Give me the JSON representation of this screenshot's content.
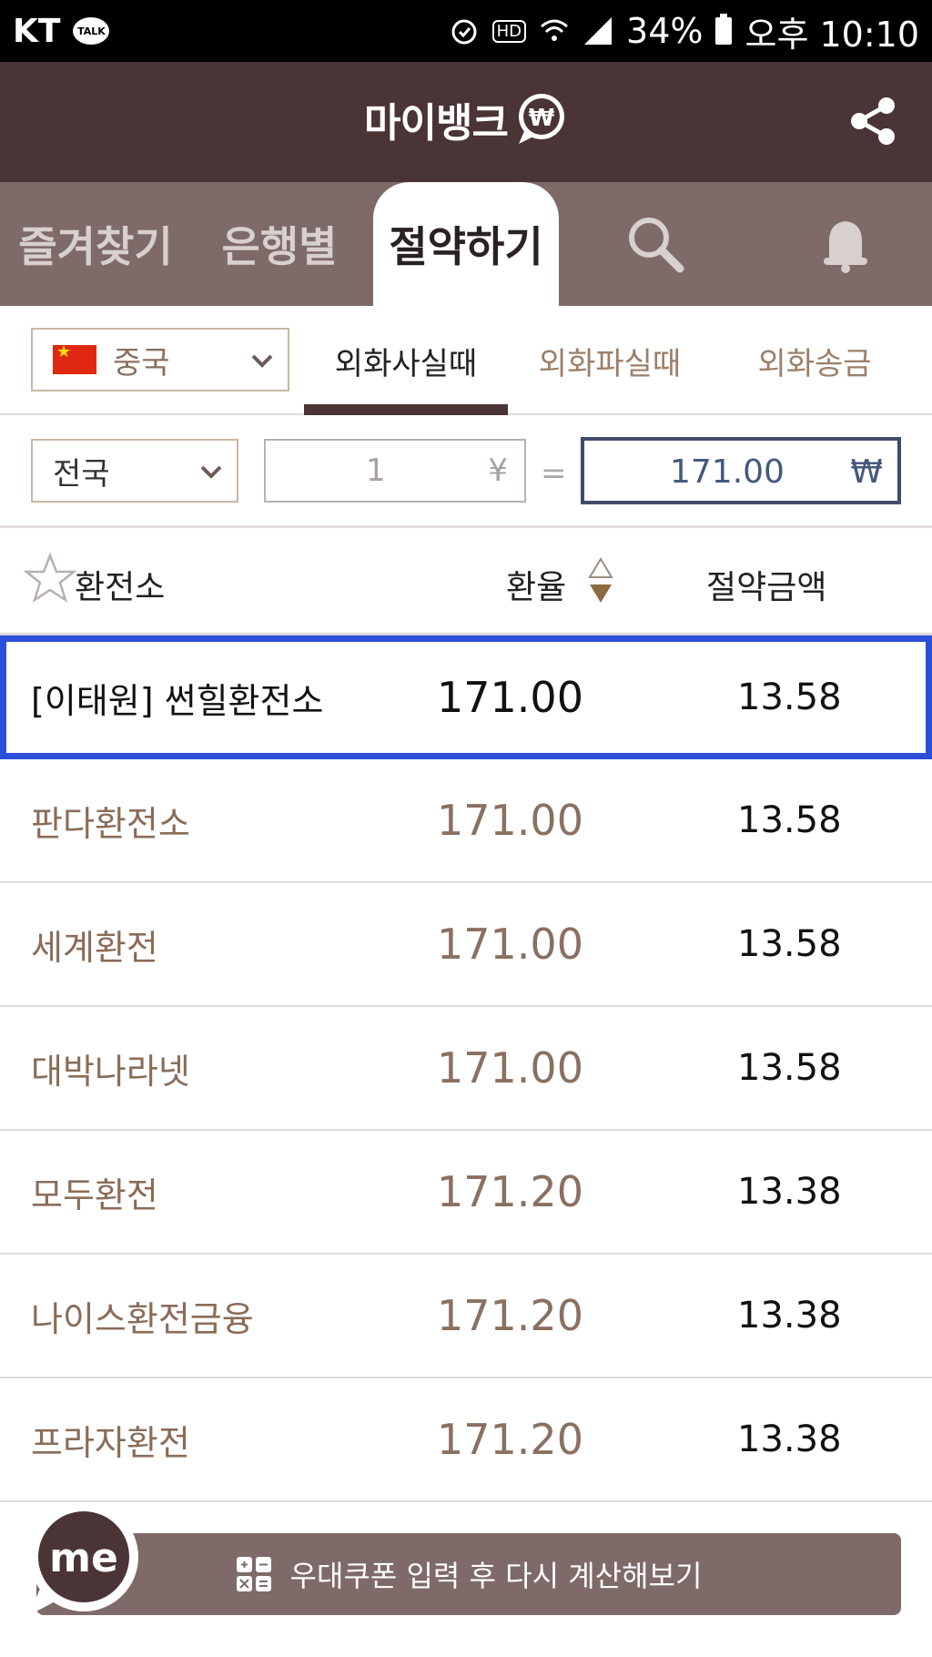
{
  "status_bar": {
    "carrier": "KT",
    "talk_badge": "TALK",
    "hd": "HD",
    "battery": "34%",
    "time": "오후 10:10"
  },
  "header": {
    "logo_text": "마이뱅크",
    "logo_mark": "₩"
  },
  "tabs": [
    {
      "label": "즐겨찾기"
    },
    {
      "label": "은행별"
    },
    {
      "label": "절약하기"
    }
  ],
  "country_select": {
    "label": "중국"
  },
  "subtabs": [
    {
      "label": "외화사실때"
    },
    {
      "label": "외화파실때"
    },
    {
      "label": "외화송금"
    }
  ],
  "calculator": {
    "region": "전국",
    "amount": "1",
    "amount_currency": "¥",
    "equals": "=",
    "result": "171.00",
    "result_currency": "₩"
  },
  "table": {
    "headers": {
      "name": "환전소",
      "rate": "환율",
      "saving": "절약금액"
    },
    "rows": [
      {
        "name": "[이태원] 썬힐환전소",
        "rate": "171.00",
        "saving": "13.58"
      },
      {
        "name": "판다환전소",
        "rate": "171.00",
        "saving": "13.58"
      },
      {
        "name": "세계환전",
        "rate": "171.00",
        "saving": "13.58"
      },
      {
        "name": "대박나라넷",
        "rate": "171.00",
        "saving": "13.58"
      },
      {
        "name": "모두환전",
        "rate": "171.20",
        "saving": "13.38"
      },
      {
        "name": "나이스환전금융",
        "rate": "171.20",
        "saving": "13.38"
      },
      {
        "name": "프라자환전",
        "rate": "171.20",
        "saving": "13.38"
      }
    ]
  },
  "coupon_button": {
    "label": "우대쿠폰 입력 후 다시 계산해보기"
  },
  "me_button": {
    "label": "me"
  }
}
